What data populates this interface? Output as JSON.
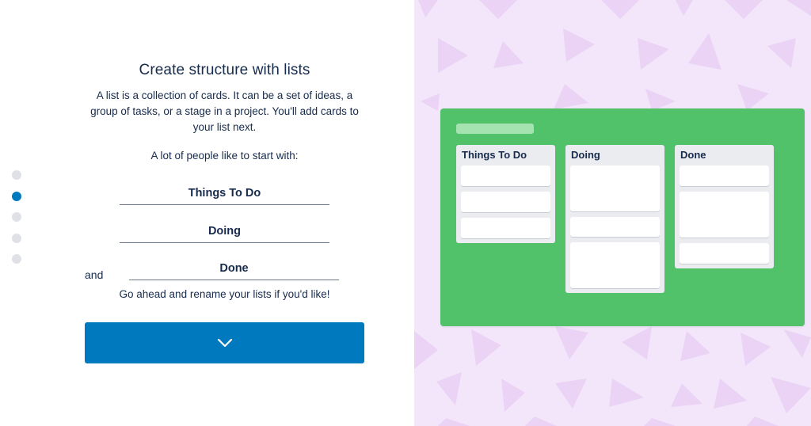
{
  "onboarding": {
    "title": "Create structure with lists",
    "description": "A list is a collection of cards. It can be a set of ideas, a group of tasks, or a stage in a project. You'll add cards to your list next.",
    "lead": "A lot of people like to start with:",
    "and_label": "and",
    "rename_note": "Go ahead and rename your lists if you'd like!",
    "list_names": [
      "Things To Do",
      "Doing",
      "Done"
    ],
    "continue_icon": "chevron-down-icon",
    "progress": {
      "total_steps": 5,
      "current_step": 2
    }
  },
  "preview": {
    "lists": [
      {
        "name": "Things To Do"
      },
      {
        "name": "Doing"
      },
      {
        "name": "Done"
      }
    ]
  },
  "colors": {
    "accent": "#0079bf",
    "board_green": "#51c16a",
    "pattern_bg": "#f3e6fa",
    "pattern_triangle": "#ead3f5",
    "list_bg": "#ebecf0",
    "text": "#172b4d"
  }
}
